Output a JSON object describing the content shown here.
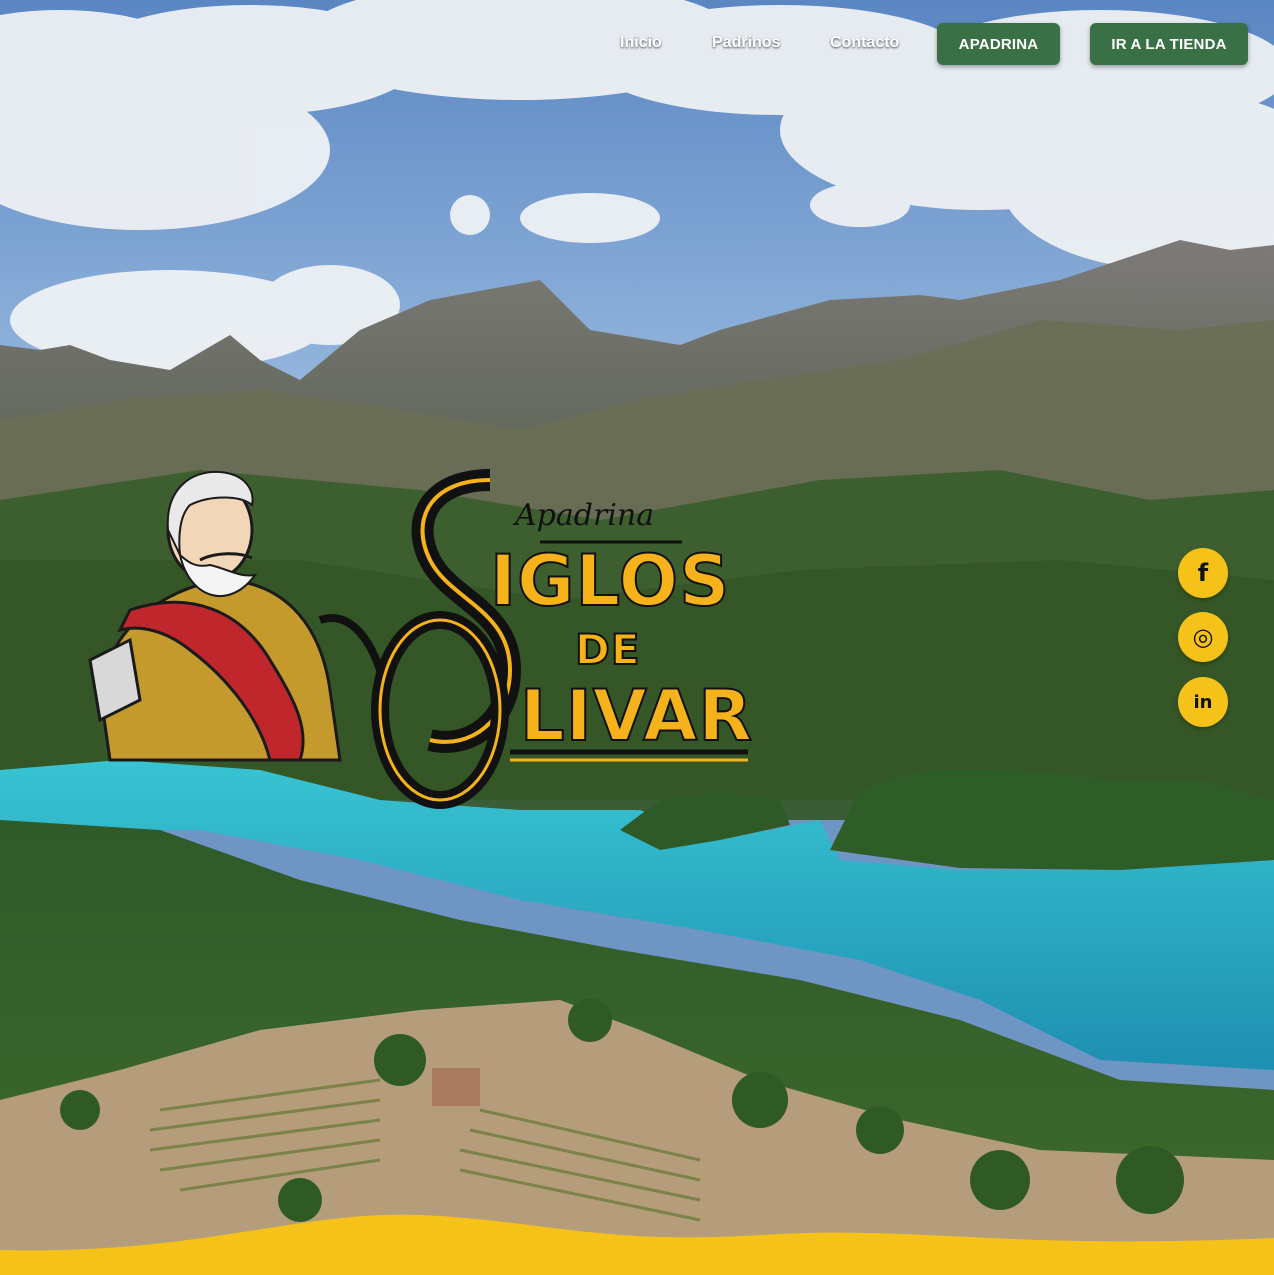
{
  "nav": {
    "links": [
      "Inicio",
      "Padrinos",
      "Contacto"
    ],
    "buttons": [
      "APADRINA",
      "IR A LA TIENDA"
    ]
  },
  "logo": {
    "script": "Apadrina",
    "line1": "IGLOS",
    "line2": "DE",
    "line3": "LIVAR",
    "initial1": "S",
    "initial2": "O"
  },
  "social": [
    {
      "name": "facebook-icon",
      "glyph": "f"
    },
    {
      "name": "instagram-icon",
      "glyph": "◎"
    },
    {
      "name": "linkedin-icon",
      "glyph": "in"
    }
  ],
  "colors": {
    "accent_yellow": "#f5c219",
    "button_green": "#3a7045",
    "lake": "#2fb6c8"
  }
}
